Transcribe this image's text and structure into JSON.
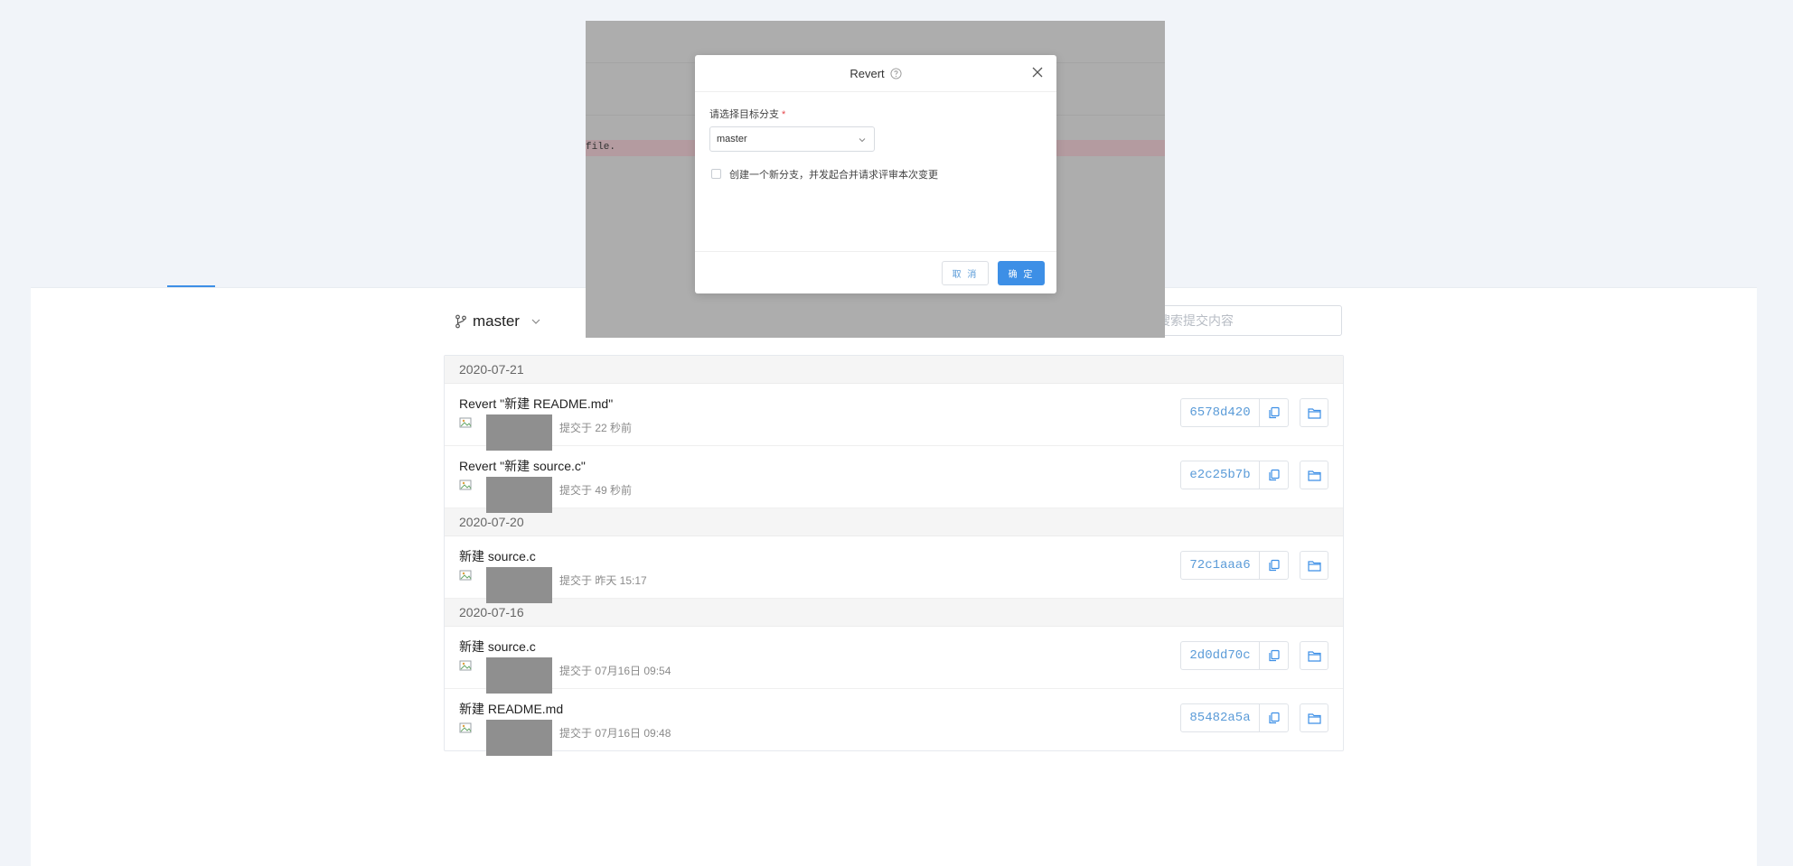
{
  "toolbar": {
    "branch_label": "master",
    "search_placeholder": "搜索提交内容"
  },
  "commit_groups": [
    {
      "date": "2020-07-21",
      "commits": [
        {
          "title": "Revert \"新建 README.md\"",
          "time": "提交于 22 秒前",
          "sha": "6578d420"
        },
        {
          "title": "Revert \"新建 source.c\"",
          "time": "提交于 49 秒前",
          "sha": "e2c25b7b"
        }
      ]
    },
    {
      "date": "2020-07-20",
      "commits": [
        {
          "title": "新建 source.c",
          "time": "提交于 昨天 15:17",
          "sha": "72c1aaa6"
        }
      ]
    },
    {
      "date": "2020-07-16",
      "commits": [
        {
          "title": "新建 source.c",
          "time": "提交于 07月16日 09:54",
          "sha": "2d0dd70c"
        },
        {
          "title": "新建 README.md",
          "time": "提交于 07月16日 09:48",
          "sha": "85482a5a"
        }
      ]
    }
  ],
  "background_diff": {
    "line_text": "file."
  },
  "modal": {
    "title": "Revert",
    "field_label": "请选择目标分支",
    "required_mark": "*",
    "selected_branch": "master",
    "new_branch_checkbox_label": "创建一个新分支，并发起合并请求评审本次变更",
    "new_branch_checked": false,
    "cancel_label": "取 消",
    "ok_label": "确 定"
  },
  "colors": {
    "accent": "#3d8fe6",
    "sha_text": "#5a9bd8",
    "page_bg": "#f1f4f9",
    "overlay": "#adadad"
  },
  "icons": [
    "branch-icon",
    "chevron-down-icon",
    "broken-image-icon",
    "copy-icon",
    "folder-icon",
    "help-circle-icon",
    "close-icon"
  ]
}
